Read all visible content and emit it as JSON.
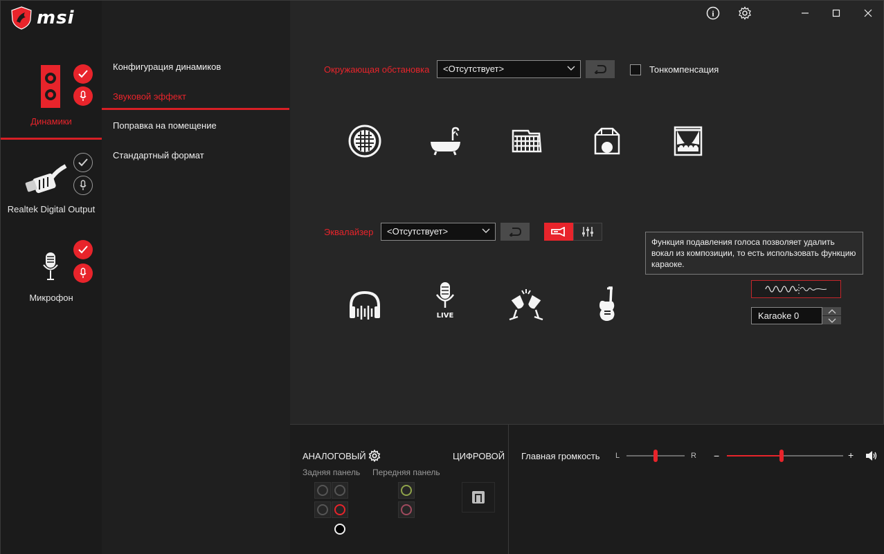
{
  "app": {
    "logo_text": "msi",
    "info_label": "i",
    "window": {
      "minimize": "—",
      "maximize": "☐",
      "close": "✕"
    }
  },
  "devices": [
    {
      "label": "Динамики",
      "active": true
    },
    {
      "label": "Realtek Digital Output",
      "active": false
    },
    {
      "label": "Микрофон",
      "active": false
    }
  ],
  "menu": {
    "items": [
      {
        "label": "Конфигурация динамиков",
        "active": false
      },
      {
        "label": "Звуковой эффект",
        "active": true
      },
      {
        "label": "Поправка на помещение",
        "active": false
      },
      {
        "label": "Стандартный формат",
        "active": false
      }
    ]
  },
  "environment": {
    "label": "Окружающая обстановка",
    "selected": "<Отсутствует>",
    "loudness_label": "Тонкомпенсация",
    "loudness_checked": false,
    "presets": [
      "stadium-icon",
      "bathtub-icon",
      "arena-icon",
      "room-icon",
      "theater-icon"
    ]
  },
  "equalizer": {
    "label": "Эквалайзер",
    "selected": "<Отсутствует>",
    "presets": [
      "headphones-icon",
      "live-mic-icon",
      "toast-icon",
      "guitar-icon"
    ],
    "live_text": "LIVE"
  },
  "tooltip": {
    "text": "Функция подавления голоса позволяет удалить вокал из композиции, то есть использовать функцию караоке."
  },
  "karaoke": {
    "value": "Karaoke 0"
  },
  "connectors": {
    "analog_title": "АНАЛОГОВЫЙ",
    "digital_title": "ЦИФРОВОЙ",
    "rear_panel": "Задняя панель",
    "front_panel": "Передняя панель"
  },
  "volume": {
    "title": "Главная громкость",
    "balance_left": "L",
    "balance_right": "R",
    "minus": "−",
    "plus": "+",
    "balance_value": 0.5,
    "level_value": 0.47
  },
  "colors": {
    "accent": "#e8242b",
    "background": "#262626",
    "sidebar": "#1b1b1b"
  }
}
